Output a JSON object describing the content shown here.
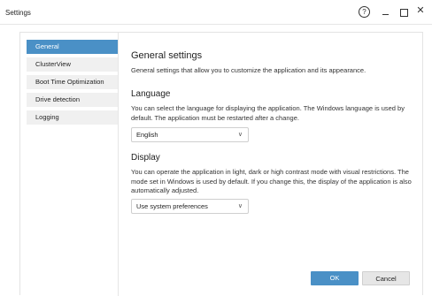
{
  "window": {
    "title": "Settings",
    "help_glyph": "?",
    "close_glyph": "✕"
  },
  "sidebar": {
    "items": [
      {
        "label": "General",
        "active": true
      },
      {
        "label": "ClusterView",
        "active": false
      },
      {
        "label": "Boot Time Optimization",
        "active": false
      },
      {
        "label": "Drive detection",
        "active": false
      },
      {
        "label": "Logging",
        "active": false
      }
    ]
  },
  "main": {
    "title": "General settings",
    "description": "General settings that allow you to customize the application and its appearance.",
    "language": {
      "heading": "Language",
      "text": "You can select the language for displaying the application. The Windows language is used by default. The application must be restarted after a change.",
      "selected": "English"
    },
    "display": {
      "heading": "Display",
      "text": "You can operate the application in light, dark or high contrast mode with visual restrictions. The mode set in Windows is used by default. If you change this, the display of the application is also automatically adjusted.",
      "selected": "Use system preferences"
    }
  },
  "buttons": {
    "ok": "OK",
    "cancel": "Cancel"
  },
  "colors": {
    "accent": "#4a90c6"
  }
}
